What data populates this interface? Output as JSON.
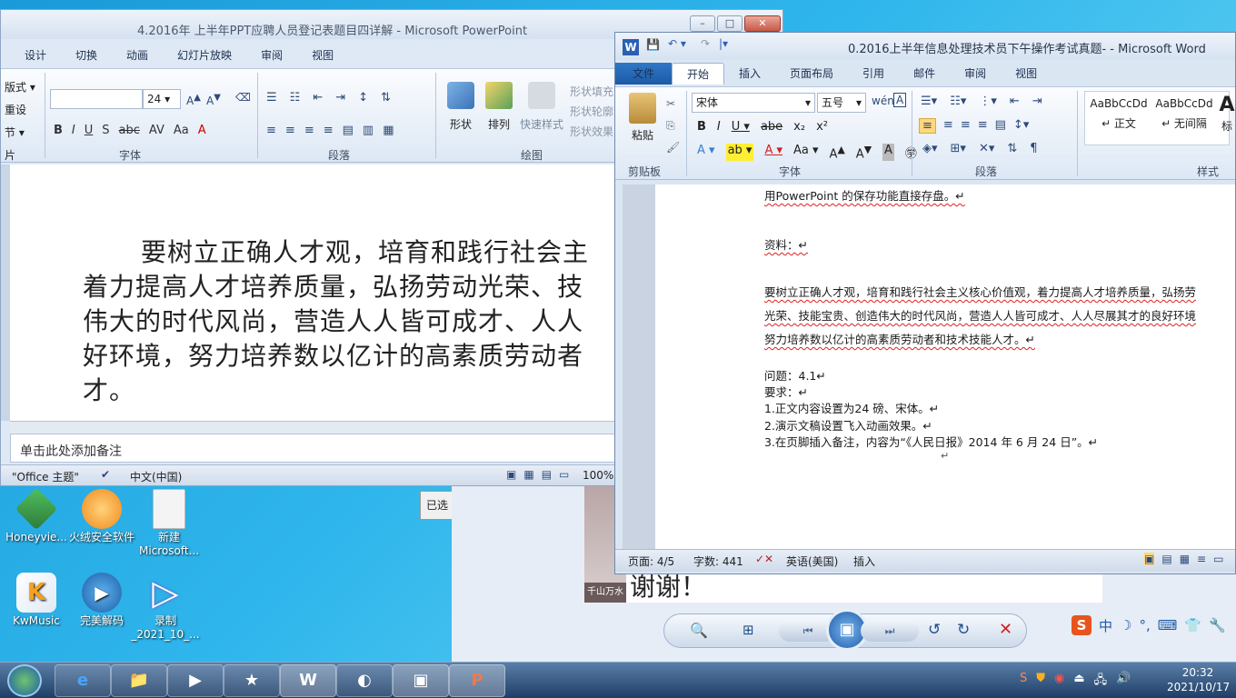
{
  "ppt": {
    "title": "4.2016年 上半年PPT应聘人员登记表题目四详解 - Microsoft PowerPoint",
    "tabs": [
      "设计",
      "切换",
      "动画",
      "幻灯片放映",
      "审阅",
      "视图"
    ],
    "left_labels": [
      "版式 ▾",
      "重设",
      "节 ▾",
      "片"
    ],
    "font_size": "24",
    "groups": {
      "font": "字体",
      "paragraph": "段落",
      "drawing": "绘图"
    },
    "drawing_buttons": {
      "shape": "形状",
      "arrange": "排列",
      "quick_style": "快速样式"
    },
    "shape_menu": [
      "形状填充",
      "形状轮廓",
      "形状效果"
    ],
    "slide_text": "要树立正确人才观，培育和践行社会主义核心价值观，着力提高人才培养质量，弘扬劳动光荣、技能宝贵、创造伟大的时代风尚，营造人人皆可成才、人人尽展其才的良好环境，努力培养数以亿计的高素质劳动者和技术技能人才。",
    "slide_lines": [
      "要树立正确人才观，培育和践行社会主",
      "着力提高人才培养质量，弘扬劳动光荣、技",
      "伟大的时代风尚，营造人人皆可成才、人人",
      "好环境，努力培养数以亿计的高素质劳动者",
      "才。"
    ],
    "notes_placeholder": "单击此处添加备注",
    "status": {
      "theme": "\"Office 主题\"",
      "language": "中文(中国)",
      "zoom": "100%"
    }
  },
  "word": {
    "title": "0.2016上半年信息处理技术员下午操作考试真题- - Microsoft Word",
    "tabs": [
      "文件",
      "开始",
      "插入",
      "页面布局",
      "引用",
      "邮件",
      "审阅",
      "视图"
    ],
    "font_name": "宋体",
    "font_size": "五号",
    "groups": {
      "clipboard": "剪贴板",
      "font": "字体",
      "paragraph": "段落",
      "styles": "样式"
    },
    "paste_label": "粘贴",
    "styles": [
      {
        "preview": "AaBbCcDd",
        "name": "↵ 正文"
      },
      {
        "preview": "AaBbCcDd",
        "name": "↵ 无间隔"
      },
      {
        "preview": "A",
        "name": "标"
      }
    ],
    "doc_lines": {
      "l1": "用PowerPoint 的保存功能直接存盘。↵",
      "l2": "资料：↵",
      "l3": "要树立正确人才观，培育和践行社会主义核心价值观，着力提高人才培养质量，弘扬劳",
      "l4": "光荣、技能宝贵、创造伟大的时代风尚，营造人人皆可成才、人人尽展其才的良好环境",
      "l5": "努力培养数以亿计的高素质劳动者和技术技能人才。↵",
      "l6": "问题：4.1↵",
      "l7": "要求：↵",
      "l8": "1.正文内容设置为24 磅、宋体。↵",
      "l9": "2.演示文稿设置飞入动画效果。↵",
      "l10": "3.在页脚插入备注，内容为“《人民日报》2014 年 6 月 24 日”。↵"
    },
    "status": {
      "page": "页面: 4/5",
      "words": "字数: 441",
      "lang": "英语(美国)",
      "mode": "插入"
    }
  },
  "desktop": {
    "icons": [
      {
        "label": "Honeyvie...",
        "color": "#3d9a4a",
        "icon": "honeyview-icon"
      },
      {
        "label": "火绒安全软件",
        "color": "#f08a1c",
        "icon": "huorong-icon"
      },
      {
        "label": "新建 Microsoft...",
        "color": "#f2f2f2",
        "icon": "access-file-icon"
      },
      {
        "label": "KwMusic",
        "color": "#f5b020",
        "icon": "kwmusic-icon"
      },
      {
        "label": "完美解码",
        "color": "#1c74c4",
        "icon": "potplayer-icon"
      },
      {
        "label": "录制 _2021_10_...",
        "color": "#7b3fc4",
        "icon": "mp4-file-icon"
      }
    ],
    "small_window_label": "已选",
    "viewer_caption": "千山万水",
    "viewer_slide_text": "谢谢！"
  },
  "taskbar": {
    "apps": [
      "start-orb",
      "ie-icon",
      "explorer-icon",
      "media-player-icon",
      "star-app-icon",
      "word-icon",
      "wps-icon",
      "photo-viewer-icon",
      "powerpoint-icon"
    ],
    "time": "20:32",
    "date": "2021/10/17",
    "ime": [
      "中",
      "☽",
      "°,",
      "⌨",
      "👕",
      "🔧"
    ]
  }
}
